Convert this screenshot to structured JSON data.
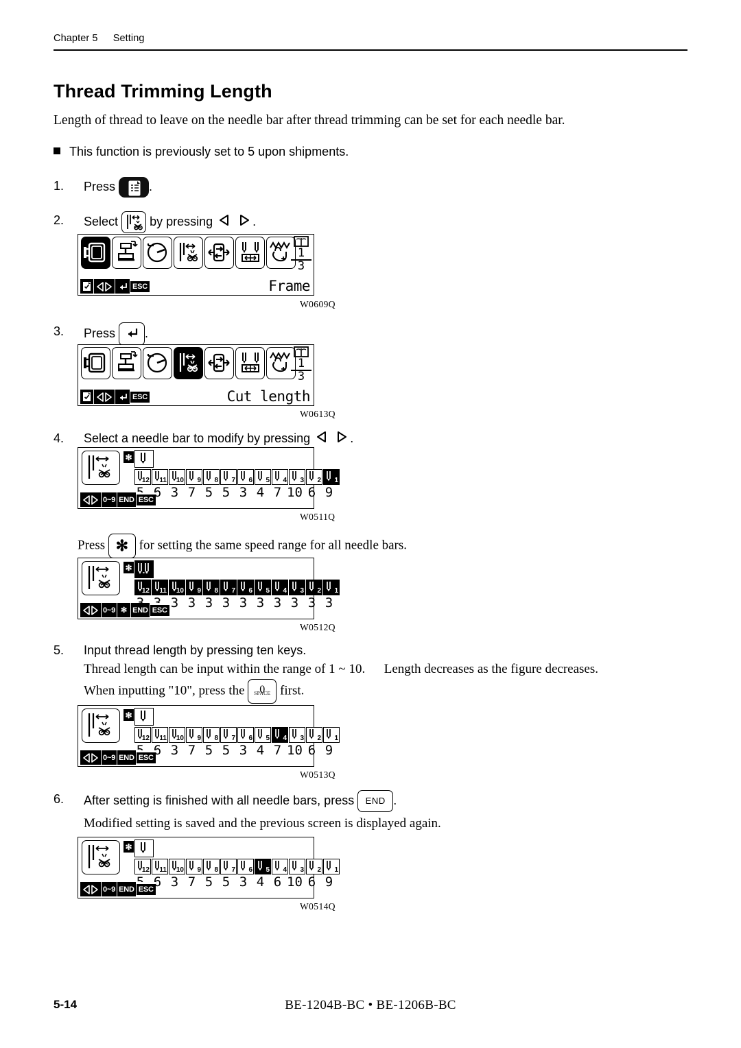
{
  "header": {
    "chapter": "Chapter 5",
    "section": "Setting"
  },
  "title": "Thread Trimming Length",
  "lead": "Length of thread to leave on the needle bar after thread trimming can be set for each needle bar.",
  "note": "This function is previously set to 5 upon shipments.",
  "steps": {
    "s1": {
      "num": "1.",
      "text_before": "Press",
      "text_after": "."
    },
    "s2": {
      "num": "2.",
      "text_before": "Select",
      "text_mid": "by pressing",
      "text_after": "."
    },
    "s3": {
      "num": "3.",
      "text_before": "Press",
      "text_after": "."
    },
    "s4": {
      "num": "4.",
      "text": "Select a needle bar to modify by pressing",
      "text_after": "."
    },
    "s4b": {
      "text_before": "Press",
      "text_after": "for setting the same speed range for all needle bars."
    },
    "s5": {
      "num": "5.",
      "heading": "Input thread length by pressing ten keys.",
      "line1": "Thread length can be input within the range of 1 ~ 10.",
      "line1b": "Length decreases as the figure decreases.",
      "line2_before": "When inputting \"10\", press the",
      "line2_after": "first."
    },
    "s6": {
      "num": "6.",
      "text_before": "After setting is finished with all needle bars, press",
      "text_after": ".",
      "line2": "Modified setting is saved and the previous screen is displayed again."
    }
  },
  "keys": {
    "menu_doc": "menu-document-key",
    "enter": "↵",
    "star": "✱",
    "end": "END",
    "zero": "0",
    "zero_sub": "SPACE"
  },
  "screens": {
    "w0609": {
      "ref": "W0609Q",
      "label": "Frame",
      "page_current": "1",
      "page_total": "3",
      "selected_index": 0,
      "icons": [
        "frame-icon",
        "presser-foot-icon",
        "speed-gauge-icon",
        "thread-trim-icon",
        "rotate-frame-icon",
        "needle-position-icon",
        "zigzag-hand-icon"
      ],
      "buttons": [
        "doc-check",
        "arrows-lr",
        "enter",
        "ESC"
      ]
    },
    "w0613": {
      "ref": "W0613Q",
      "label": "Cut length",
      "page_current": "1",
      "page_total": "3",
      "selected_index": 3,
      "icons": [
        "frame-icon",
        "presser-foot-icon",
        "speed-gauge-icon",
        "thread-trim-icon",
        "rotate-frame-icon",
        "needle-position-icon",
        "zigzag-hand-icon"
      ],
      "buttons": [
        "doc-check",
        "arrows-lr",
        "enter",
        "ESC"
      ]
    },
    "w0511": {
      "ref": "W0511Q",
      "all_mode": false,
      "bars": [
        "12",
        "11",
        "10",
        "9",
        "8",
        "7",
        "6",
        "5",
        "4",
        "3",
        "2",
        "1"
      ],
      "values": [
        "5",
        "6",
        "3",
        "7",
        "5",
        "5",
        "3",
        "4",
        "7",
        "10",
        "6",
        "9"
      ],
      "selected_bar": "1",
      "buttons": [
        "arrows-lr",
        "0~9",
        "END",
        "ESC"
      ]
    },
    "w0512": {
      "ref": "W0512Q",
      "all_mode": true,
      "bars": [
        "12",
        "11",
        "10",
        "9",
        "8",
        "7",
        "6",
        "5",
        "4",
        "3",
        "2",
        "1"
      ],
      "values": [
        "3",
        "3",
        "3",
        "3",
        "3",
        "3",
        "3",
        "3",
        "3",
        "3",
        "3",
        "3"
      ],
      "selected_bar": "all",
      "buttons": [
        "arrows-lr",
        "0~9",
        "star",
        "END",
        "ESC"
      ]
    },
    "w0513": {
      "ref": "W0513Q",
      "all_mode": false,
      "bars": [
        "12",
        "11",
        "10",
        "9",
        "8",
        "7",
        "6",
        "5",
        "4",
        "3",
        "2",
        "1"
      ],
      "values": [
        "5",
        "6",
        "3",
        "7",
        "5",
        "5",
        "3",
        "4",
        "7",
        "10",
        "6",
        "9"
      ],
      "selected_bar": "4",
      "buttons": [
        "arrows-lr",
        "0~9",
        "END",
        "ESC"
      ]
    },
    "w0514": {
      "ref": "W0514Q",
      "all_mode": false,
      "bars": [
        "12",
        "11",
        "10",
        "9",
        "8",
        "7",
        "6",
        "5",
        "4",
        "3",
        "2",
        "1"
      ],
      "values": [
        "5",
        "6",
        "3",
        "7",
        "5",
        "5",
        "3",
        "4",
        "6",
        "10",
        "6",
        "9"
      ],
      "selected_bar": "5",
      "buttons": [
        "arrows-lr",
        "0~9",
        "END",
        "ESC"
      ]
    }
  },
  "footer": {
    "page_number": "5-14",
    "models": "BE-1204B-BC • BE-1206B-BC"
  }
}
